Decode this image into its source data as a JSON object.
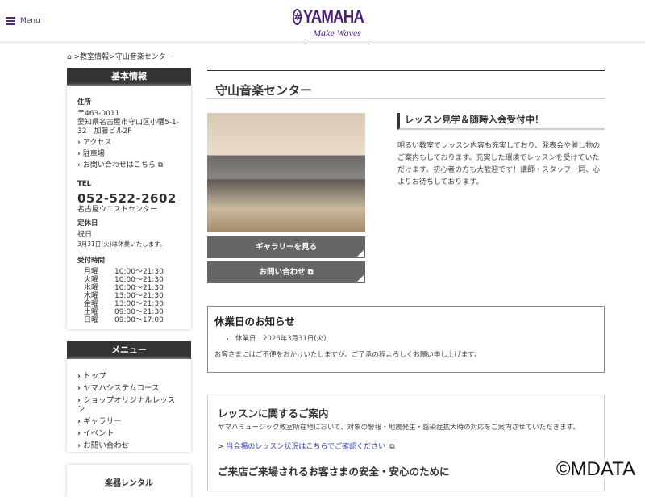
{
  "header": {
    "menu_label": "Menu",
    "logo_text": "YAMAHA",
    "logo_tagline": "Make Waves"
  },
  "breadcrumb": {
    "items": [
      "教室情報",
      "守山音楽センター"
    ],
    "sep": ">"
  },
  "sidebar": {
    "info_title": "基本情報",
    "address_label": "住所",
    "postal": "〒463-0011",
    "address": "愛知県名古屋市守山区小幡5-1-32　加藤ビル2F",
    "links": [
      "アクセス",
      "駐車場",
      "お問い合わせはこちら"
    ],
    "tel_label": "TEL",
    "tel": "052-522-2602",
    "tel_center": "名古屋ウエストセンター",
    "closed_label": "定休日",
    "closed": "祝日",
    "closed_note": "3月31日(火)は休業いたします。",
    "hours_label": "受付時間",
    "hours": [
      [
        "月曜",
        "10:00～21:30"
      ],
      [
        "火曜",
        "10:00～21:30"
      ],
      [
        "水曜",
        "10:00～21:30"
      ],
      [
        "木曜",
        "13:00～21:30"
      ],
      [
        "金曜",
        "13:00～21:30"
      ],
      [
        "土曜",
        "09:00～21:30"
      ],
      [
        "日曜",
        "09:00～17:00"
      ]
    ],
    "menu_title": "メニュー",
    "menu": [
      "トップ",
      "ヤマハシステムコース",
      "ショップオリジナルレッスン",
      "ギャラリー",
      "イベント",
      "お問い合わせ"
    ],
    "rental_title": "楽器レンタル"
  },
  "main": {
    "title": "守山音楽センター",
    "gallery_button": "ギャラリーを見る",
    "contact_button": "お問い合わせ",
    "intro_heading": "レッスン見学＆随時入会受付中！",
    "intro_text": "明るい教室でレッスン内容も充実しており、発表会や催し物のご案内もしております。充実した環境でレッスンを受けていただけます。初心者の方も大歓迎です！講師・スタッフ一同、心よりお待ちしております。",
    "notice_title": "休業日のお知らせ",
    "notice_item": "休業日　2026年3月31日(火)",
    "notice_text": "お客さまにはご不便をおかけいたしますが、ご了承の程よろしくお願い申し上げます。",
    "lesson_title": "レッスンに関するご案内",
    "lesson_text": "ヤマハミュージック教室所在地において、対象の警報・地震発生・感染症拡大時の対応をご案内させていただきます。",
    "lesson_link": "当会場のレッスン状況はこちらでご確認ください",
    "safety_title": "ご来店ご来場されるお客さまの安全・安心のために"
  },
  "watermark": "©MDATA"
}
